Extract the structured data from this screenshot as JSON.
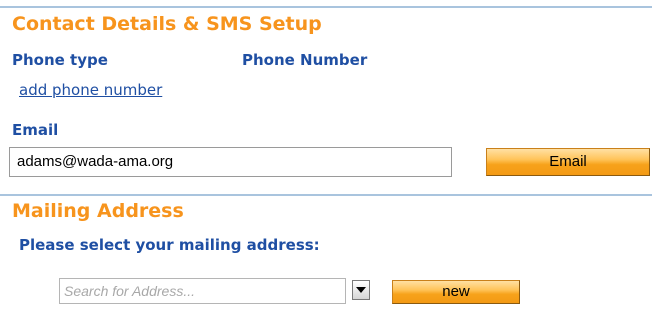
{
  "contact": {
    "title": "Contact Details & SMS Setup",
    "phone_type_label": "Phone type",
    "phone_number_label": "Phone Number",
    "add_phone_link": "add phone number",
    "email_label": "Email",
    "email_value": "adams@wada-ama.org",
    "email_button": "Email"
  },
  "mailing": {
    "title": "Mailing Address",
    "prompt": "Please select your mailing address:",
    "search_placeholder": "Search for Address...",
    "new_button": "new"
  },
  "colors": {
    "section_title": "#f7941d",
    "label_blue": "#1f4fa3",
    "rule": "#a9c4de",
    "button_orange": "#f7a21b"
  },
  "icons": {
    "dropdown": "chevron-down-icon"
  }
}
